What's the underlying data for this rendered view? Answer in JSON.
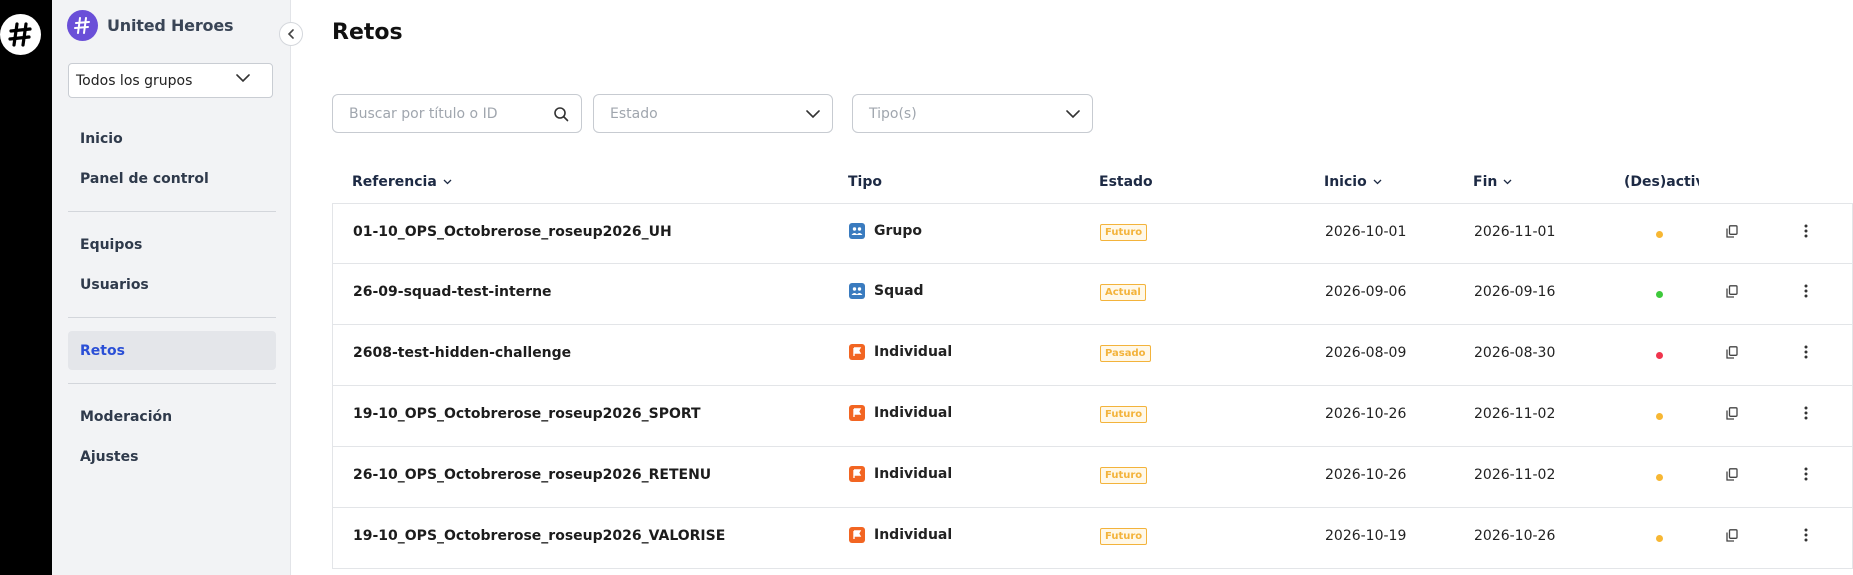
{
  "brand": {
    "name": "United Heroes"
  },
  "group_select": {
    "value": "Todos los grupos"
  },
  "nav": {
    "items": [
      {
        "label": "Inicio"
      },
      {
        "label": "Panel de control"
      },
      {
        "label": "Equipos"
      },
      {
        "label": "Usuarios"
      },
      {
        "label": "Retos",
        "active": true
      },
      {
        "label": "Moderación"
      },
      {
        "label": "Ajustes"
      }
    ]
  },
  "page": {
    "title": "Retos"
  },
  "filters": {
    "search_placeholder": "Buscar por título o ID",
    "estado_placeholder": "Estado",
    "tipo_placeholder": "Tipo(s)"
  },
  "table": {
    "headers": {
      "referencia": "Referencia",
      "tipo": "Tipo",
      "estado": "Estado",
      "inicio": "Inicio",
      "fin": "Fin",
      "activacion": "(Des)activ"
    },
    "rows": [
      {
        "ref": "01-10_OPS_Octobrerose_roseup2026_UH",
        "type": "Grupo",
        "type_icon": "group-icon",
        "status": "Futuro",
        "start": "2026-10-01",
        "end": "2026-11-01",
        "dot_color": "#f7b733"
      },
      {
        "ref": "26-09-squad-test-interne",
        "type": "Squad",
        "type_icon": "group-icon",
        "status": "Actual",
        "start": "2026-09-06",
        "end": "2026-09-16",
        "dot_color": "#3ec93b"
      },
      {
        "ref": "2608-test-hidden-challenge",
        "type": "Individual",
        "type_icon": "flag-icon",
        "status": "Pasado",
        "start": "2026-08-09",
        "end": "2026-08-30",
        "dot_color": "#f0354d"
      },
      {
        "ref": "19-10_OPS_Octobrerose_roseup2026_SPORT",
        "type": "Individual",
        "type_icon": "flag-icon",
        "status": "Futuro",
        "start": "2026-10-26",
        "end": "2026-11-02",
        "dot_color": "#f7b733"
      },
      {
        "ref": "26-10_OPS_Octobrerose_roseup2026_RETENU",
        "type": "Individual",
        "type_icon": "flag-icon",
        "status": "Futuro",
        "start": "2026-10-26",
        "end": "2026-11-02",
        "dot_color": "#f7b733"
      },
      {
        "ref": "19-10_OPS_Octobrerose_roseup2026_VALORISE",
        "type": "Individual",
        "type_icon": "flag-icon",
        "status": "Futuro",
        "start": "2026-10-19",
        "end": "2026-10-26",
        "dot_color": "#f7b733"
      }
    ]
  },
  "colors": {
    "accent": "#2a4fd6",
    "brand": "#6a4fd8",
    "group_type": "#3a7bbf",
    "individual_type": "#f26522",
    "status_badge": "#f3b33b"
  }
}
